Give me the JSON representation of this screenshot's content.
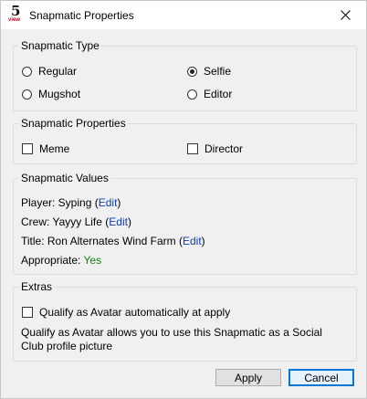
{
  "window": {
    "title": "Snapmatic Properties",
    "icon": {
      "glyph": "5",
      "caption": "view"
    }
  },
  "type_group": {
    "title": "Snapmatic Type",
    "options": [
      {
        "label": "Regular",
        "checked": false
      },
      {
        "label": "Selfie",
        "checked": true
      },
      {
        "label": "Mugshot",
        "checked": false
      },
      {
        "label": "Editor",
        "checked": false
      }
    ]
  },
  "props_group": {
    "title": "Snapmatic Properties",
    "checks": [
      {
        "label": "Meme",
        "checked": false
      },
      {
        "label": "Director",
        "checked": false
      }
    ]
  },
  "values_group": {
    "title": "Snapmatic Values",
    "player": {
      "prefix": "Player: Syping",
      "link": "Edit"
    },
    "crew": {
      "prefix": "Crew: Yayyy Life",
      "link": "Edit"
    },
    "title_line": {
      "prefix": "Title: Ron Alternates Wind Farm",
      "link": "Edit"
    },
    "appropriate": {
      "prefix": "Appropriate:",
      "value": "Yes"
    }
  },
  "extras_group": {
    "title": "Extras",
    "avatar_check": {
      "label": "Qualify as Avatar automatically at apply",
      "checked": false
    },
    "description": "Qualify as Avatar allows you to use this Snapmatic as a Social Club profile picture"
  },
  "buttons": {
    "apply": "Apply",
    "cancel": "Cancel"
  }
}
